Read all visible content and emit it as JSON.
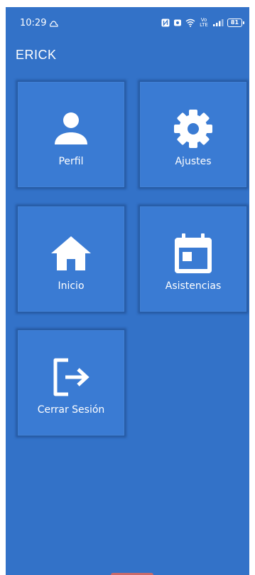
{
  "status_bar": {
    "time": "10:29",
    "network_label": "Vo LTE",
    "battery": "81"
  },
  "header": {
    "user_name": "ERICK"
  },
  "menu": {
    "tiles": [
      {
        "label": "Perfil",
        "icon": "person-icon"
      },
      {
        "label": "Ajustes",
        "icon": "gear-icon"
      },
      {
        "label": "Inicio",
        "icon": "home-icon"
      },
      {
        "label": "Asistencias",
        "icon": "calendar-icon"
      },
      {
        "label": "Cerrar Sesión",
        "icon": "logout-icon"
      }
    ]
  },
  "colors": {
    "background": "#3372c8",
    "tile": "#3a7bd3",
    "text": "#ffffff"
  }
}
